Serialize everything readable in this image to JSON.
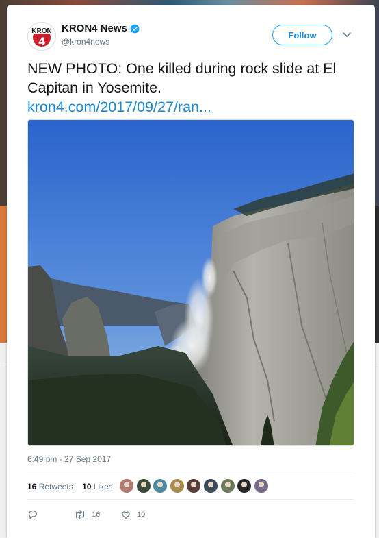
{
  "tweet": {
    "author_name": "KRON4 News",
    "author_handle": "@kron4news",
    "avatar_logo_text": "KRON",
    "avatar_logo_number": "4",
    "follow_label": "Follow",
    "text": "NEW PHOTO: One killed during rock slide at El Capitan in Yosemite.",
    "link_text": "kron4.com/2017/09/27/ran...",
    "timestamp": "6:49 pm - 27 Sep 2017",
    "retweet_count": "16",
    "retweet_label": "Retweets",
    "like_count": "10",
    "like_label": "Likes",
    "reply_icon": "reply-icon",
    "retweet_icon": "retweet-icon",
    "like_icon": "heart-icon",
    "action_retweet_count": "16",
    "action_like_count": "10"
  },
  "colors": {
    "accent": "#1da1f2",
    "link": "#1b8ad3",
    "muted": "#657786",
    "verified": "#1da1f2",
    "logo_red": "#cc1f2d"
  },
  "likers": [
    {
      "color": "#b07a6e"
    },
    {
      "color": "#3a4a3a"
    },
    {
      "color": "#4d8aa0"
    },
    {
      "color": "#a88a4a"
    },
    {
      "color": "#5a3e3a"
    },
    {
      "color": "#3a4a5a"
    },
    {
      "color": "#6a7a5a"
    },
    {
      "color": "#2a2a2a"
    },
    {
      "color": "#7a6a8a"
    }
  ]
}
